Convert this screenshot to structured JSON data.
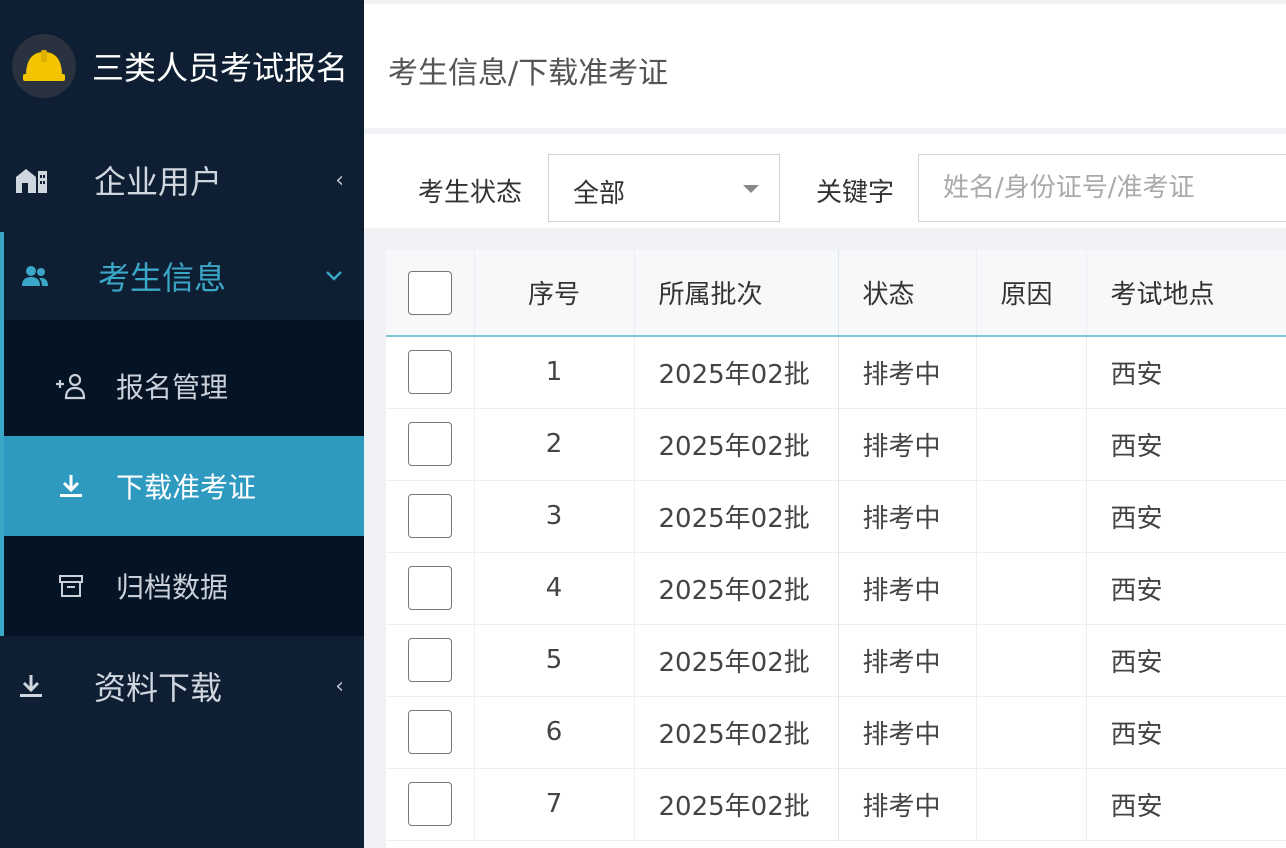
{
  "app": {
    "title": "三类人员考试报名",
    "logo_icon": "hard-hat-icon"
  },
  "sidebar": {
    "items": [
      {
        "label": "企业用户",
        "icon": "building-icon",
        "arrow": "‹"
      },
      {
        "label": "考生信息",
        "icon": "users-icon",
        "arrow": "⌄",
        "expanded": true
      },
      {
        "label": "资料下载",
        "icon": "download-icon",
        "arrow": "‹"
      }
    ],
    "submenu": [
      {
        "label": "报名管理",
        "icon": "add-user-icon"
      },
      {
        "label": "下载准考证",
        "icon": "download-icon",
        "active": true
      },
      {
        "label": "归档数据",
        "icon": "archive-icon"
      }
    ]
  },
  "header": {
    "breadcrumb": "考生信息/下载准考证"
  },
  "filter": {
    "status_label": "考生状态",
    "status_value": "全部",
    "keyword_label": "关键字",
    "keyword_placeholder": "姓名/身份证号/准考证"
  },
  "table": {
    "columns": [
      "序号",
      "所属批次",
      "状态",
      "原因",
      "考试地点"
    ],
    "rows": [
      {
        "seq": "1",
        "batch": "2025年02批",
        "status": "排考中",
        "reason": "",
        "place": "西安"
      },
      {
        "seq": "2",
        "batch": "2025年02批",
        "status": "排考中",
        "reason": "",
        "place": "西安"
      },
      {
        "seq": "3",
        "batch": "2025年02批",
        "status": "排考中",
        "reason": "",
        "place": "西安"
      },
      {
        "seq": "4",
        "batch": "2025年02批",
        "status": "排考中",
        "reason": "",
        "place": "西安"
      },
      {
        "seq": "5",
        "batch": "2025年02批",
        "status": "排考中",
        "reason": "",
        "place": "西安"
      },
      {
        "seq": "6",
        "batch": "2025年02批",
        "status": "排考中",
        "reason": "",
        "place": "西安"
      },
      {
        "seq": "7",
        "batch": "2025年02批",
        "status": "排考中",
        "reason": "",
        "place": "西安"
      }
    ]
  },
  "colors": {
    "sidebar_bg": "#0f1f33",
    "submenu_bg": "#051424",
    "accent": "#2f9ac0",
    "accent_text": "#3aa7c7",
    "logo_yellow": "#f5c400"
  }
}
